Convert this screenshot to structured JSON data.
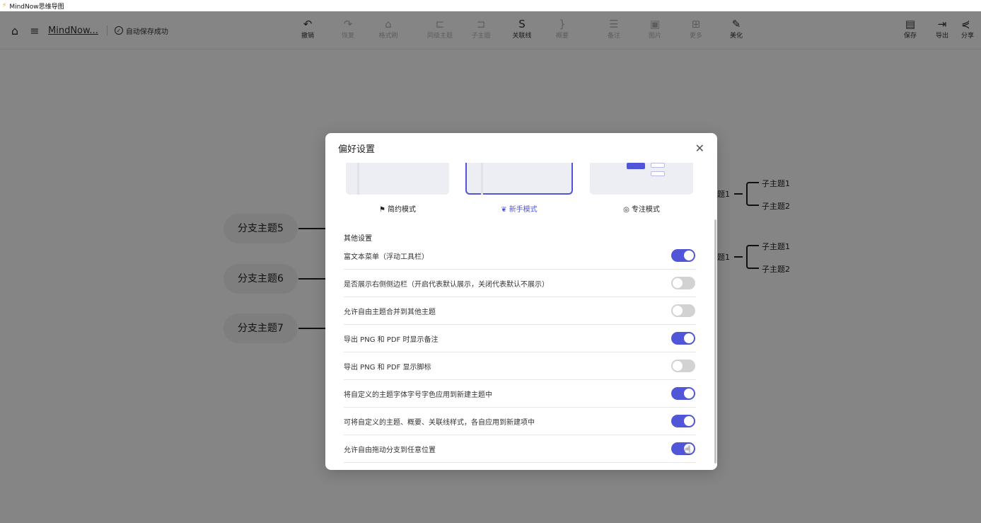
{
  "titlebar": {
    "app_title": "MindNow思维导图"
  },
  "toolbar": {
    "doc_title": "MindNow...",
    "save_status": "自动保存成功",
    "tools": [
      {
        "label": "撤销",
        "icon": "undo-icon",
        "glyph": "↶",
        "enabled": true
      },
      {
        "label": "恢复",
        "icon": "redo-icon",
        "glyph": "↷",
        "enabled": false
      },
      {
        "label": "格式刷",
        "icon": "format-brush-icon",
        "glyph": "⌂",
        "enabled": false
      },
      {
        "label": "同级主题",
        "icon": "sibling-topic-icon",
        "glyph": "⊏",
        "enabled": false
      },
      {
        "label": "子主题",
        "icon": "child-topic-icon",
        "glyph": "⊐",
        "enabled": false
      },
      {
        "label": "关联线",
        "icon": "relation-line-icon",
        "glyph": "S",
        "enabled": true
      },
      {
        "label": "概要",
        "icon": "summary-icon",
        "glyph": "}",
        "enabled": false
      },
      {
        "label": "备注",
        "icon": "note-icon",
        "glyph": "☰",
        "enabled": false
      },
      {
        "label": "图片",
        "icon": "image-icon",
        "glyph": "▣",
        "enabled": false
      },
      {
        "label": "更多",
        "icon": "more-icon",
        "glyph": "⊞",
        "enabled": false
      },
      {
        "label": "美化",
        "icon": "beautify-wand-icon",
        "glyph": "✎",
        "enabled": true
      }
    ],
    "right_tools": [
      {
        "label": "保存",
        "icon": "save-icon",
        "glyph": "▤"
      },
      {
        "label": "导出",
        "icon": "export-icon",
        "glyph": "⇥"
      },
      {
        "label": "分享",
        "icon": "share-icon",
        "glyph": "⋞"
      }
    ]
  },
  "canvas": {
    "branches": [
      "分支主题5",
      "分支主题6",
      "分支主题7"
    ],
    "right_topic_fragment": "题1",
    "subtopics": [
      "子主题1",
      "子主题2"
    ]
  },
  "modal": {
    "title": "偏好设置",
    "modes": [
      {
        "label": "简约模式",
        "icon": "flag-icon",
        "glyph": "⚑",
        "active": false
      },
      {
        "label": "新手模式",
        "icon": "sprout-icon",
        "glyph": "❦",
        "active": true
      },
      {
        "label": "专注模式",
        "icon": "target-icon",
        "glyph": "◎",
        "active": false
      }
    ],
    "section_title": "其他设置",
    "settings": [
      {
        "label": "富文本菜单（浮动工具栏）",
        "on": true
      },
      {
        "label": "是否展示右侧侧边栏（开启代表默认展示，关闭代表默认不展示）",
        "on": false
      },
      {
        "label": "允许自由主题合并到其他主题",
        "on": false
      },
      {
        "label": "导出 PNG 和 PDF 时显示备注",
        "on": true
      },
      {
        "label": "导出 PNG 和 PDF 显示脚标",
        "on": false
      },
      {
        "label": "将自定义的主题字体字号字色应用到新建主题中",
        "on": true
      },
      {
        "label": "可将自定义的主题、概要、关联线样式，各自应用到新建项中",
        "on": true
      },
      {
        "label": "允许自由拖动分支到任意位置",
        "on": true
      }
    ]
  },
  "colors": {
    "accent": "#5156d9",
    "toggle_off": "#d2d2d2",
    "overlay": "rgba(0,0,0,0.48)"
  }
}
